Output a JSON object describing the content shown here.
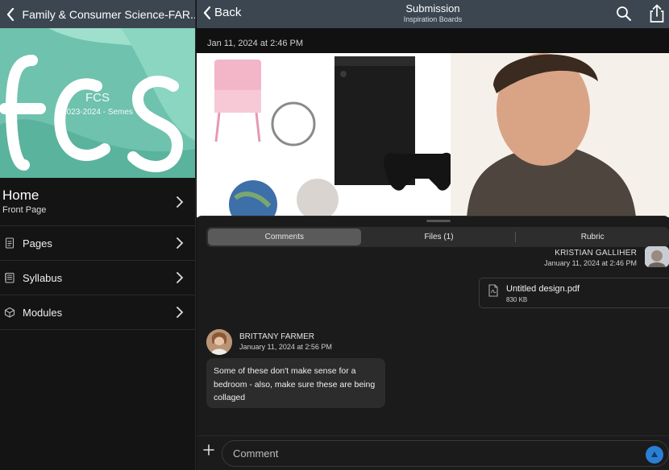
{
  "sidebar": {
    "header_title": "Family & Consumer Science-FAR...",
    "banner_code": "FCS",
    "banner_term": "2023-2024 - Semes",
    "home_label": "Home",
    "home_sub": "Front Page",
    "items": [
      {
        "label": "Pages",
        "icon": "document-icon"
      },
      {
        "label": "Syllabus",
        "icon": "syllabus-icon"
      },
      {
        "label": "Modules",
        "icon": "modules-icon"
      }
    ]
  },
  "topbar": {
    "back_label": "Back",
    "title": "Submission",
    "subtitle": "Inspiration Boards"
  },
  "submission": {
    "timestamp": "Jan 11, 2024 at 2:46 PM"
  },
  "tabs": [
    {
      "label": "Comments",
      "active": true
    },
    {
      "label": "Files (1)",
      "active": false
    },
    {
      "label": "Rubric",
      "active": false
    }
  ],
  "comments": {
    "student_name": "KRISTIAN GALLIHER",
    "student_date": "January 11, 2024 at 2:46 PM",
    "attachment_name": "Untitled design.pdf",
    "attachment_size": "830 KB",
    "teacher_name": "BRITTANY FARMER",
    "teacher_date": "January 11, 2024 at 2:56 PM",
    "teacher_message": "Some of these don't make sense for a bedroom - also, make sure these are being collaged"
  },
  "composer": {
    "placeholder": "Comment"
  },
  "colors": {
    "header_bg": "#3b4650",
    "banner_bg": "#7dc9b5",
    "send_blue": "#2a7fd4"
  }
}
